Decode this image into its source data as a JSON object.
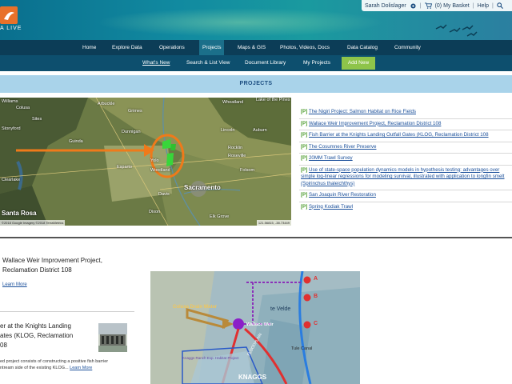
{
  "banner": {
    "logo_text": "A LIVE",
    "user": {
      "name": "Sarah Dolislager",
      "basket": "(0) My Basket",
      "help": "Help"
    }
  },
  "main_nav": [
    "Home",
    "Explore Data",
    "Operations",
    "Projects",
    "Maps & GIS",
    "Photos, Videos, Docs",
    "Data Catalog",
    "Community"
  ],
  "main_nav_active": "Projects",
  "sub_nav": [
    "What's New",
    "Search & List View",
    "Document Library",
    "My Projects"
  ],
  "sub_nav_current": "What's New",
  "add_new_label": "Add New",
  "section_title": "PROJECTS",
  "map": {
    "labels": [
      "Williams",
      "Arbuckle",
      "Colusa",
      "Grimes",
      "Wheatland",
      "Lake of the Pines",
      "Sites",
      "Stonyford",
      "Dunnigan",
      "Lincoln",
      "Auburn",
      "Guinda",
      "Rocklin",
      "Roseville",
      "Esparto",
      "Yolo",
      "Woodland",
      "Folsom",
      "Clearlake",
      "Davis",
      "Santa Rosa",
      "Dixon",
      "Elk Grove",
      "Sacramento"
    ],
    "footer": "©2018 Google Imagery ©2018 TerraMetrics",
    "coords": "121.56815, -38.73449"
  },
  "projects": [
    {
      "tag": "[P]",
      "title": "The Nigiri Project: Salmon Habitat on Rice Fields"
    },
    {
      "tag": "[P]",
      "title": "Wallace Weir Improvement Project, Reclamation District 108"
    },
    {
      "tag": "[P]",
      "title": "Fish Barrier at the Knights Landing Outfall Gates (KLOG, Reclamation District 108"
    },
    {
      "tag": "[P]",
      "title": "The Cosumnes River Preserve"
    },
    {
      "tag": "[P]",
      "title": "20MM Trawl Survey"
    },
    {
      "tag": "[P]",
      "title": "Use of state-space population dynamics models in hypothesis testing: advantages over simple log-linear regressions for modeling survival, illustrated with application to longfin smelt (Spirinchus thaleichthys)"
    },
    {
      "tag": "[P]",
      "title": "San Joaquin River Restoration"
    },
    {
      "tag": "[P]",
      "title": "Spring Kodiak Trawl"
    }
  ],
  "features": [
    {
      "title_line1": "Wallace Weir Improvement Project,",
      "title_line2": "Reclamation District 108",
      "learn_more": "Learn More"
    },
    {
      "title_line1": "er at the Knights Landing",
      "title_line2": "ates (KLOG, Reclamation",
      "title_line3": "08",
      "body_line1": "ed project consists of constructing a positive fish barrier",
      "body_line2": "ntream side of the existing KLOG...",
      "learn_more": "Learn More"
    }
  ],
  "diagram_labels": {
    "drain": "Colusa Drain Water",
    "weir": "Wallace Weir",
    "velde": "te Velde",
    "tule": "Tule Canal",
    "bypass": "Knaggs Ranch Exp. Habitat Project",
    "knaggs": "KNAGGS",
    "flood": "FLOODPLAIN",
    "a": "A",
    "b": "B",
    "c": "C"
  },
  "colors": {
    "nav": "#0c3d57",
    "subnav": "#0d4f6e",
    "add_new": "#8ec44a",
    "section_bar": "#a9d3ea",
    "link": "#1a4f9a",
    "tag": "#4a9a2a"
  }
}
